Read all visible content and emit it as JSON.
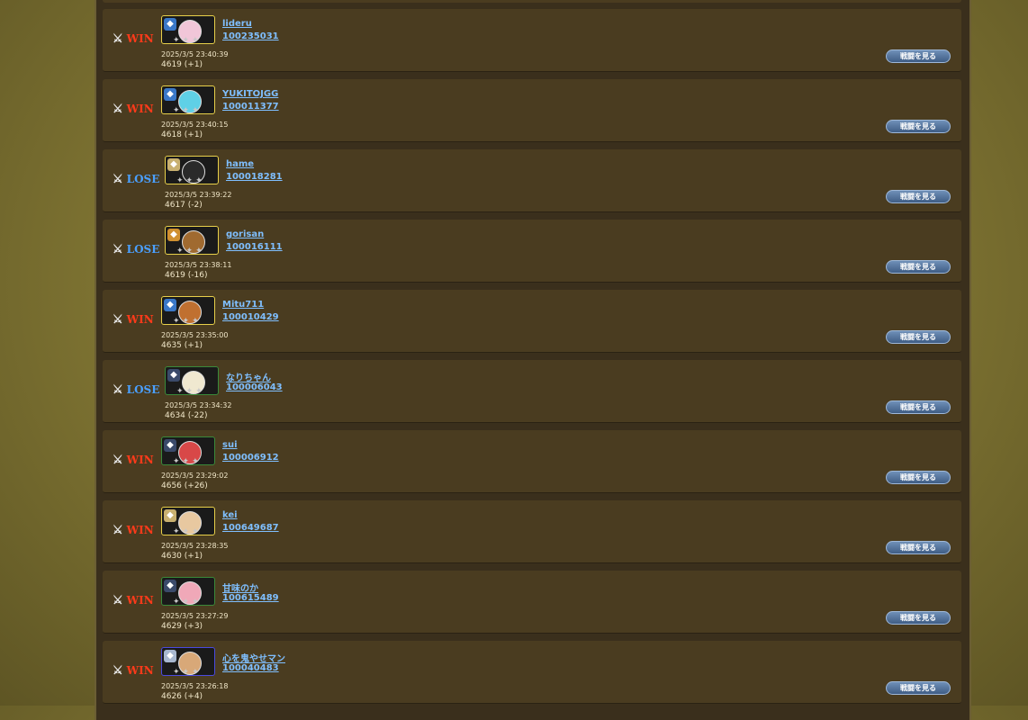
{
  "view_button_label": "戦闘を見る",
  "colors": {
    "win": "#ff3a1a",
    "lose": "#4aa0ff",
    "link": "#7fbfff",
    "row_bg": "#4a3c20"
  },
  "battles": [
    {
      "result": "WIN",
      "name": "lideru",
      "id": "100235031",
      "time": "2025/3/5 23:40:39",
      "rating": "4619 (+1)",
      "emblem_icon": "blue-dragon-emblem",
      "face": "#f1c6d8"
    },
    {
      "result": "WIN",
      "name": "YUKITOJGG",
      "id": "100011377",
      "time": "2025/3/5 23:40:15",
      "rating": "4618 (+1)",
      "emblem_icon": "blue-dragon-emblem",
      "face": "#5fd0e6"
    },
    {
      "result": "LOSE",
      "name": "hame",
      "id": "100018281",
      "time": "2025/3/5 23:39:22",
      "rating": "4617 (-2)",
      "emblem_icon": "beige-dragon-emblem",
      "face": "#2a2a2a"
    },
    {
      "result": "LOSE",
      "name": "gorisan",
      "id": "100016111",
      "time": "2025/3/5 23:38:11",
      "rating": "4619 (-16)",
      "emblem_icon": "orange-dragon-emblem",
      "face": "#a06a30"
    },
    {
      "result": "WIN",
      "name": "Mitu711",
      "id": "100010429",
      "time": "2025/3/5 23:35:00",
      "rating": "4635 (+1)",
      "emblem_icon": "blue-dragon-emblem",
      "face": "#c07030"
    },
    {
      "result": "LOSE",
      "name": "なりちゃん",
      "id": "100006043",
      "time": "2025/3/5 23:34:32",
      "rating": "4634 (-22)",
      "emblem_icon": "dark-knight-emblem",
      "face": "#f0e8d0"
    },
    {
      "result": "WIN",
      "name": "sui",
      "id": "100006912",
      "time": "2025/3/5 23:29:02",
      "rating": "4656 (+26)",
      "emblem_icon": "dark-knight-emblem",
      "face": "#d84848"
    },
    {
      "result": "WIN",
      "name": "kei",
      "id": "100649687",
      "time": "2025/3/5 23:28:35",
      "rating": "4630 (+1)",
      "emblem_icon": "beige-dragon-emblem",
      "face": "#e8c8a0"
    },
    {
      "result": "WIN",
      "name": "甘味のか",
      "id": "100615489",
      "time": "2025/3/5 23:27:29",
      "rating": "4629 (+3)",
      "emblem_icon": "dark-knight-emblem",
      "face": "#f0a8b8"
    },
    {
      "result": "WIN",
      "name": "心を鬼やせマン",
      "id": "100040483",
      "time": "2025/3/5 23:26:18",
      "rating": "4626 (+4)",
      "emblem_icon": "silver-dragon-emblem",
      "face": "#d8a878"
    }
  ]
}
